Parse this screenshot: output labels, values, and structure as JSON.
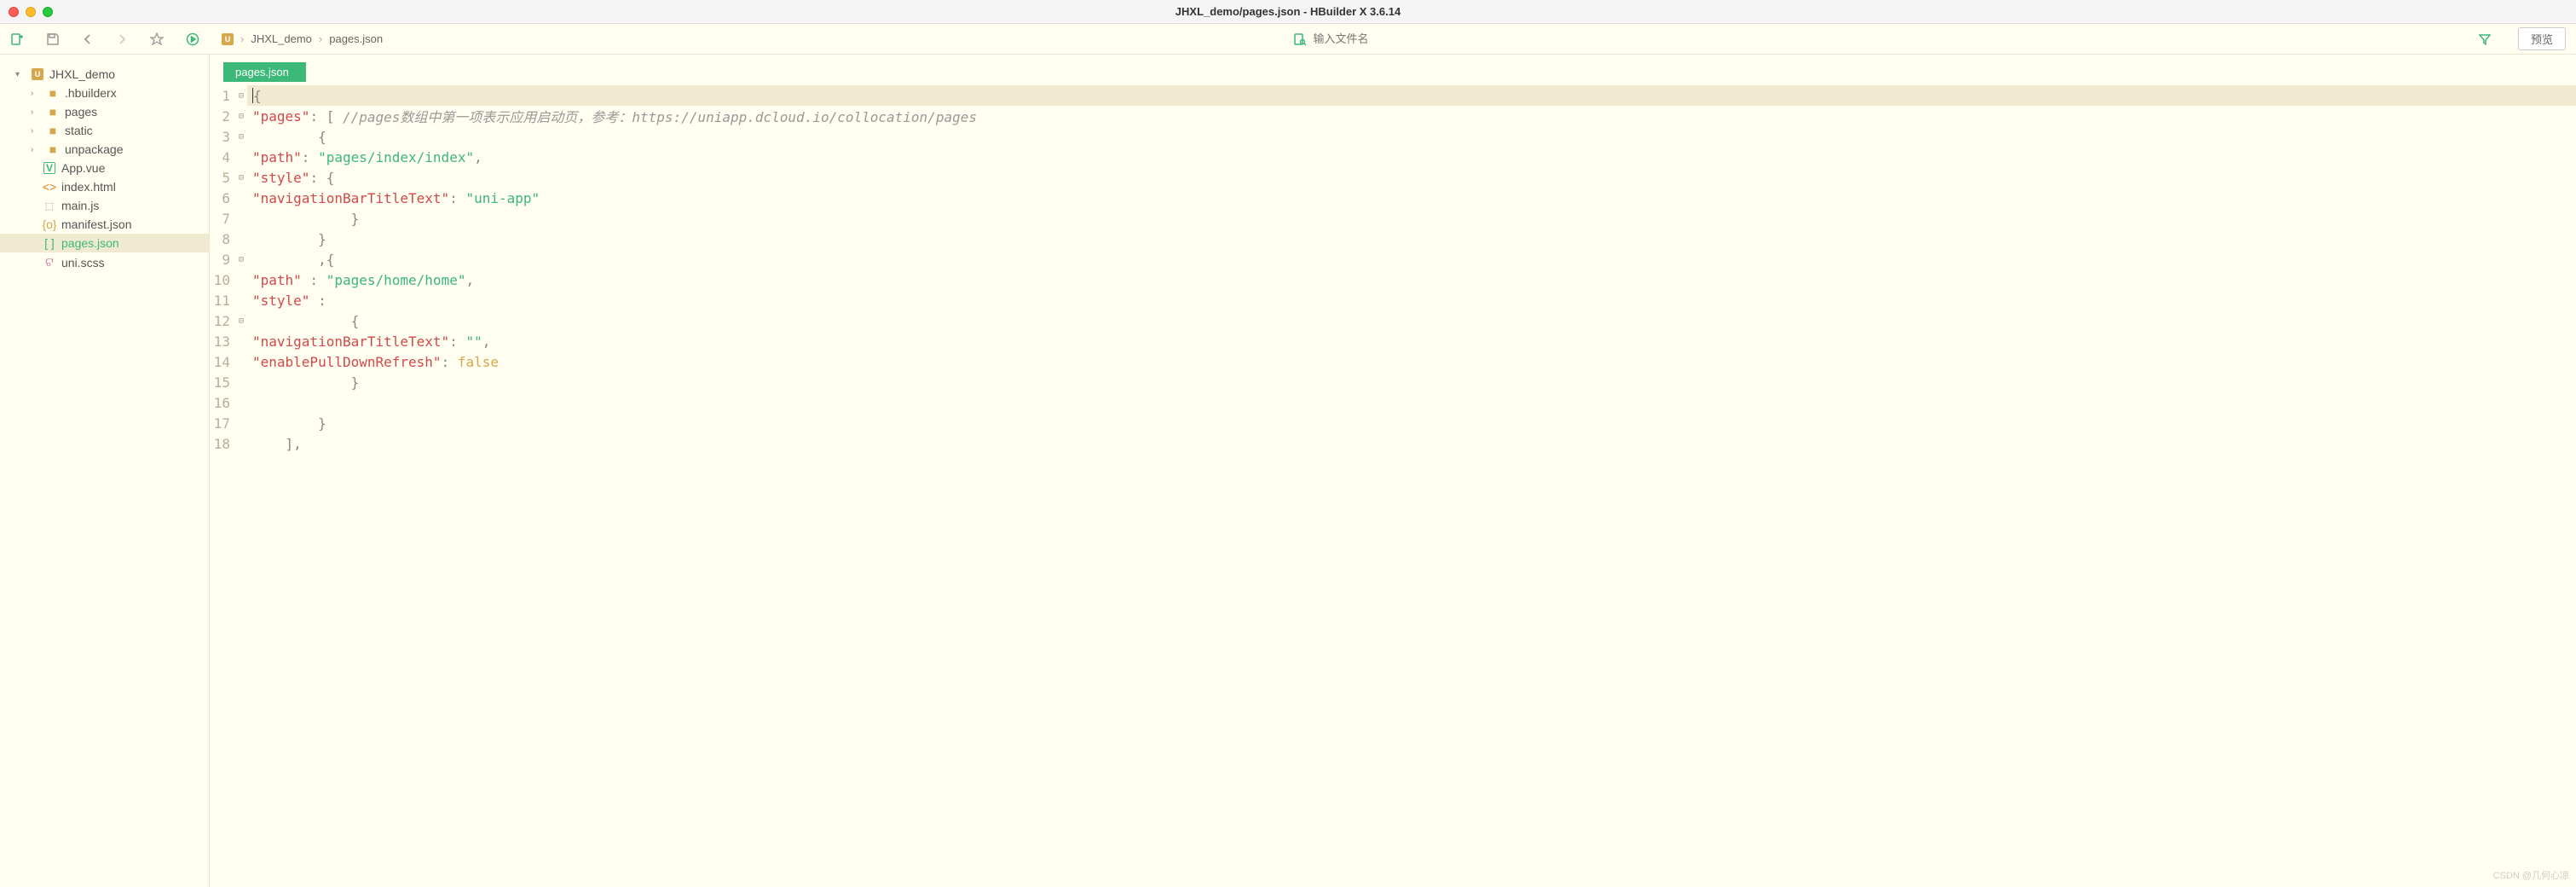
{
  "window": {
    "title": "JHXL_demo/pages.json - HBuilder X 3.6.14"
  },
  "breadcrumb": {
    "project": "JHXL_demo",
    "file": "pages.json"
  },
  "search": {
    "placeholder": "输入文件名"
  },
  "preview_label": "预览",
  "sidebar": {
    "root": "JHXL_demo",
    "items": [
      {
        "name": ".hbuilderx",
        "type": "folder"
      },
      {
        "name": "pages",
        "type": "folder"
      },
      {
        "name": "static",
        "type": "folder"
      },
      {
        "name": "unpackage",
        "type": "folder"
      },
      {
        "name": "App.vue",
        "type": "vue"
      },
      {
        "name": "index.html",
        "type": "html"
      },
      {
        "name": "main.js",
        "type": "js"
      },
      {
        "name": "manifest.json",
        "type": "json"
      },
      {
        "name": "pages.json",
        "type": "json",
        "active": true
      },
      {
        "name": "uni.scss",
        "type": "scss"
      }
    ]
  },
  "tab": {
    "label": "pages.json"
  },
  "code": {
    "l1": "{",
    "l2_key": "\"pages\"",
    "l2_punct": ": [ ",
    "l2_comment": "//pages数组中第一项表示应用启动页，参考：https://uniapp.dcloud.io/collocation/pages",
    "l3": "        {",
    "l4_k": "\"path\"",
    "l4_p": ": ",
    "l4_v": "\"pages/index/index\"",
    "l4_e": ",",
    "l5_k": "\"style\"",
    "l5_p": ": {",
    "l6_k": "\"navigationBarTitleText\"",
    "l6_p": ": ",
    "l6_v": "\"uni-app\"",
    "l7": "            }",
    "l8": "        }",
    "l9": "        ,{",
    "l10_k": "\"path\"",
    "l10_p": " : ",
    "l10_v": "\"pages/home/home\"",
    "l10_e": ",",
    "l11_k": "\"style\"",
    "l11_p": " :",
    "l12": "            {",
    "l13_k": "\"navigationBarTitleText\"",
    "l13_p": ": ",
    "l13_v": "\"\"",
    "l13_e": ",",
    "l14_k": "\"enablePullDownRefresh\"",
    "l14_p": ": ",
    "l14_v": "false",
    "l15": "            }",
    "l16": "",
    "l17": "        }",
    "l18": "    ],"
  },
  "watermark": "CSDN @几何心凉"
}
